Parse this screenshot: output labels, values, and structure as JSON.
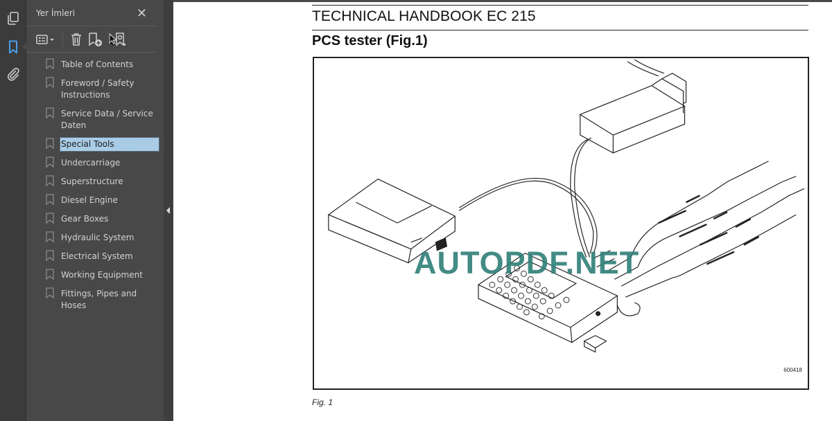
{
  "sidebar_rail": {
    "icons": [
      "pages-icon",
      "bookmark-icon",
      "attachment-icon"
    ],
    "active": "bookmark-icon",
    "accent_color": "#4a9fe8"
  },
  "bookmarks_panel": {
    "title": "Yer İmleri",
    "close_label": "✕",
    "tools": [
      "options-menu-icon",
      "delete-bookmark-icon",
      "add-bookmark-icon",
      "find-current-bookmark-icon"
    ],
    "items": [
      {
        "label": "Table of Contents",
        "selected": false
      },
      {
        "label": "Foreword / Safety Instructions",
        "selected": false
      },
      {
        "label": "Service Data / Service Daten",
        "selected": false
      },
      {
        "label": "Special Tools",
        "selected": true
      },
      {
        "label": "Undercarriage",
        "selected": false
      },
      {
        "label": "Superstructure",
        "selected": false
      },
      {
        "label": "Diesel Engine",
        "selected": false
      },
      {
        "label": "Gear Boxes",
        "selected": false
      },
      {
        "label": "Hydraulic System",
        "selected": false
      },
      {
        "label": "Electrical System",
        "selected": false
      },
      {
        "label": "Working Equipment",
        "selected": false
      },
      {
        "label": "Fittings, Pipes and Hoses",
        "selected": false
      }
    ],
    "selected_color": "#a8cce6"
  },
  "document": {
    "header": "TECHNICAL HANDBOOK EC 215",
    "section_title": "PCS tester (Fig.1)",
    "figure_code": "600418",
    "figure_caption": "Fig. 1",
    "watermark": "AUTOPDF.NET",
    "watermark_color": "#2f7f78"
  }
}
